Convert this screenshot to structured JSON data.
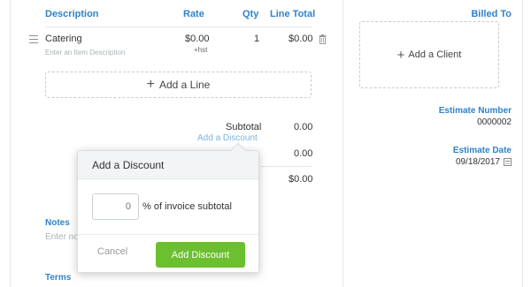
{
  "table": {
    "headers": {
      "description": "Description",
      "rate": "Rate",
      "qty": "Qty",
      "line_total": "Line Total"
    },
    "items": [
      {
        "name": "Catering",
        "description_placeholder": "Enter an Item Description",
        "rate": "$0.00",
        "tax": "+hst",
        "qty": "1",
        "line_total": "$0.00"
      }
    ],
    "add_line_label": "Add a Line"
  },
  "client": {
    "billed_to_label": "Billed To",
    "add_client_label": "Add a Client"
  },
  "estimate": {
    "number_label": "Estimate Number",
    "number": "0000002",
    "date_label": "Estimate Date",
    "date": "09/18/2017"
  },
  "summary": {
    "subtotal_label": "Subtotal",
    "subtotal": "0.00",
    "add_discount_link": "Add a Discount",
    "discount_value": "0.00",
    "total": "$0.00"
  },
  "notes": {
    "label": "Notes",
    "placeholder": "Enter notes"
  },
  "terms": {
    "label": "Terms"
  },
  "discount_popover": {
    "title": "Add a Discount",
    "input_placeholder": "0",
    "suffix": "% of invoice subtotal",
    "cancel_label": "Cancel",
    "confirm_label": "Add Discount"
  },
  "icons": {
    "drag": "drag-handle-icon",
    "delete": "trash-icon",
    "add": "plus-icon",
    "date": "calendar-icon"
  },
  "colors": {
    "accent_blue": "#2f83c8",
    "primary_green": "#6cbf2e",
    "link_light_blue": "#7db3de"
  }
}
